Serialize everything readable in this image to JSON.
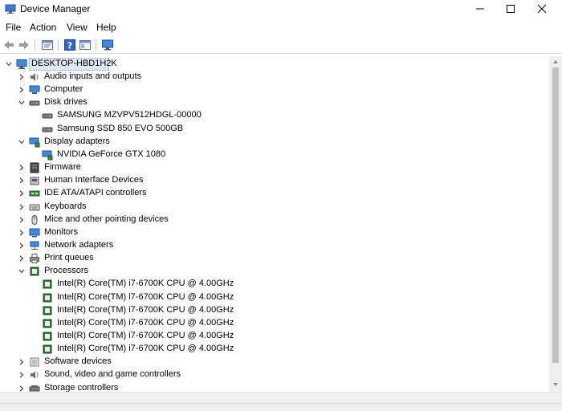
{
  "window": {
    "title": "Device Manager"
  },
  "menu": {
    "file": "File",
    "action": "Action",
    "view": "View",
    "help": "Help"
  },
  "toolbar": {
    "icons": [
      "back-arrow-icon",
      "forward-arrow-icon",
      "properties-icon",
      "help-icon",
      "show-hide-icon",
      "computer-screen-icon"
    ]
  },
  "tree": {
    "root": "DESKTOP-HBD1H2K",
    "items": [
      {
        "label": "Audio inputs and outputs",
        "level": 1,
        "expander": "collapsed",
        "icon": "speaker-icon"
      },
      {
        "label": "Computer",
        "level": 1,
        "expander": "collapsed",
        "icon": "computer-icon"
      },
      {
        "label": "Disk drives",
        "level": 1,
        "expander": "expanded",
        "icon": "disk-drive-icon"
      },
      {
        "label": "SAMSUNG MZVPV512HDGL-00000",
        "level": 2,
        "expander": "none",
        "icon": "disk-drive-icon"
      },
      {
        "label": "Samsung SSD 850 EVO 500GB",
        "level": 2,
        "expander": "none",
        "icon": "disk-drive-icon"
      },
      {
        "label": "Display adapters",
        "level": 1,
        "expander": "expanded",
        "icon": "display-adapter-icon"
      },
      {
        "label": "NVIDIA GeForce GTX 1080",
        "level": 2,
        "expander": "none",
        "icon": "display-adapter-icon"
      },
      {
        "label": "Firmware",
        "level": 1,
        "expander": "collapsed",
        "icon": "firmware-icon"
      },
      {
        "label": "Human Interface Devices",
        "level": 1,
        "expander": "collapsed",
        "icon": "hid-icon"
      },
      {
        "label": "IDE ATA/ATAPI controllers",
        "level": 1,
        "expander": "collapsed",
        "icon": "ide-controller-icon"
      },
      {
        "label": "Keyboards",
        "level": 1,
        "expander": "collapsed",
        "icon": "keyboard-icon"
      },
      {
        "label": "Mice and other pointing devices",
        "level": 1,
        "expander": "collapsed",
        "icon": "mouse-icon"
      },
      {
        "label": "Monitors",
        "level": 1,
        "expander": "collapsed",
        "icon": "monitor-icon"
      },
      {
        "label": "Network adapters",
        "level": 1,
        "expander": "collapsed",
        "icon": "network-adapter-icon"
      },
      {
        "label": "Print queues",
        "level": 1,
        "expander": "collapsed",
        "icon": "printer-icon"
      },
      {
        "label": "Processors",
        "level": 1,
        "expander": "expanded",
        "icon": "processor-icon"
      },
      {
        "label": "Intel(R) Core(TM) i7-6700K CPU @ 4.00GHz",
        "level": 2,
        "expander": "none",
        "icon": "processor-icon"
      },
      {
        "label": "Intel(R) Core(TM) i7-6700K CPU @ 4.00GHz",
        "level": 2,
        "expander": "none",
        "icon": "processor-icon"
      },
      {
        "label": "Intel(R) Core(TM) i7-6700K CPU @ 4.00GHz",
        "level": 2,
        "expander": "none",
        "icon": "processor-icon"
      },
      {
        "label": "Intel(R) Core(TM) i7-6700K CPU @ 4.00GHz",
        "level": 2,
        "expander": "none",
        "icon": "processor-icon"
      },
      {
        "label": "Intel(R) Core(TM) i7-6700K CPU @ 4.00GHz",
        "level": 2,
        "expander": "none",
        "icon": "processor-icon"
      },
      {
        "label": "Intel(R) Core(TM) i7-6700K CPU @ 4.00GHz",
        "level": 2,
        "expander": "none",
        "icon": "processor-icon"
      },
      {
        "label": "Software devices",
        "level": 1,
        "expander": "collapsed",
        "icon": "software-device-icon"
      },
      {
        "label": "Sound, video and game controllers",
        "level": 1,
        "expander": "collapsed",
        "icon": "speaker-icon"
      },
      {
        "label": "Storage controllers",
        "level": 1,
        "expander": "collapsed",
        "icon": "storage-controller-icon"
      }
    ]
  },
  "colors": {
    "selection": "#dfe9f5",
    "accent": "#1e6fd1"
  }
}
